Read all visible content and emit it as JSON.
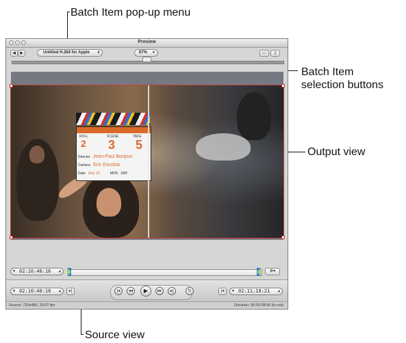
{
  "callouts": {
    "batch_item_popup": "Batch Item pop-up menu",
    "batch_item_selection_line1": "Batch Item",
    "batch_item_selection_line2": "selection buttons",
    "output_view": "Output view",
    "source_view": "Source view"
  },
  "window": {
    "title": "Preview",
    "batch_popup_value": "Untitled H.264 for Apple",
    "zoom_value": "67%",
    "prev_arrow": "◀",
    "next_arrow": "▶"
  },
  "video": {
    "slate_roll": "2",
    "slate_scene": "3",
    "slate_take": "5",
    "slate_director": "Jean-Paul Bonjour",
    "slate_camera": "Eric Escobar",
    "slate_date": "May 19",
    "slate_roll_label": "ROLL",
    "slate_scene_label": "SCENE",
    "slate_take_label": "TAKE",
    "slate_director_label": "Director",
    "slate_camera_label": "Camera",
    "slate_date_label": "Date",
    "slate_mos_label": "MOS",
    "slate_day_label": "DAY"
  },
  "timecodes": {
    "upper_left": "02:10:40:16",
    "lower_left": "02:10:40:16",
    "lower_right": "02:11:18:21"
  },
  "status": {
    "source": "Source: 720x480, 29.97 fps",
    "duration": "Duration: 00:00:38:06 (in-out)"
  },
  "colors": {
    "frame_outline": "#c93a3a",
    "in_marker": "#3a7bd5"
  }
}
